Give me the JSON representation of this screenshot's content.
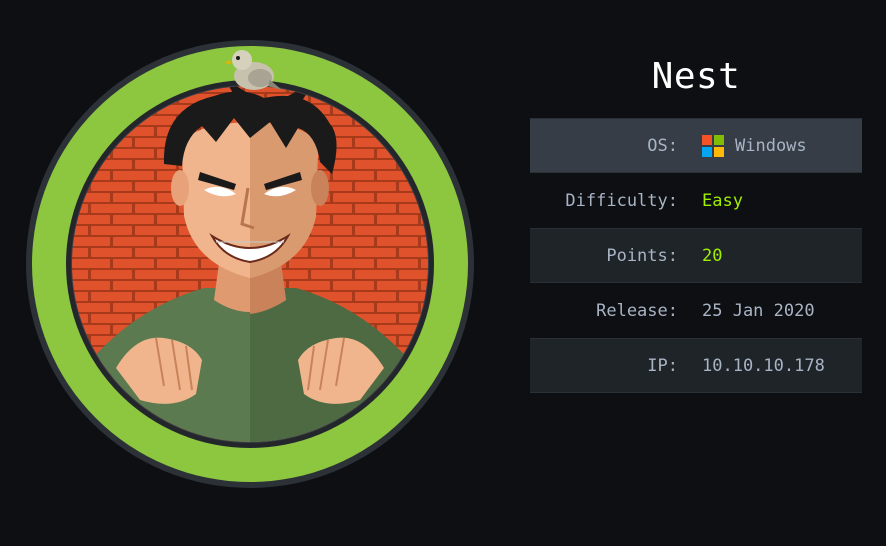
{
  "machine": {
    "name": "Nest"
  },
  "info_rows": [
    {
      "label": "OS:",
      "value": "Windows",
      "icon": "windows-logo-icon"
    },
    {
      "label": "Difficulty:",
      "value": "Easy"
    },
    {
      "label": "Points:",
      "value": "20"
    },
    {
      "label": "Release:",
      "value": "25 Jan 2020"
    },
    {
      "label": "IP:",
      "value": "10.10.10.178"
    }
  ],
  "colors": {
    "background": "#0d0f12",
    "ring": "#8dc63f",
    "accent_green": "#9fef00",
    "brick": "#e0522c",
    "mortar": "#a83a1c",
    "shirt": "#5b7a4f"
  },
  "windows_logo_colors": [
    "#f35325",
    "#81bc06",
    "#05a6f0",
    "#ffba08"
  ]
}
